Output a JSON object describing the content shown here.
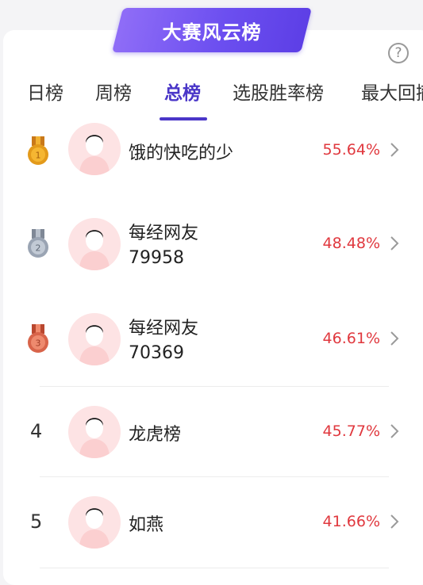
{
  "banner": {
    "title": "大赛风云榜"
  },
  "help_icon": "question-circle-icon",
  "tabs": [
    {
      "label": "日榜",
      "active": false
    },
    {
      "label": "周榜",
      "active": false
    },
    {
      "label": "总榜",
      "active": true
    },
    {
      "label": "选股胜率榜",
      "active": false
    },
    {
      "label": "最大回撤",
      "active": false
    }
  ],
  "colors": {
    "accent": "#4a36c8",
    "banner": "#6c4ff0",
    "positive": "#e0383e",
    "gold": "#e39a1b",
    "silver": "#9aa4b3",
    "bronze": "#d8644a"
  },
  "rankings": [
    {
      "rank": "1",
      "medal": "gold-medal-icon",
      "name": "饿的快吃的少",
      "name2": "",
      "pct": "55.64%"
    },
    {
      "rank": "2",
      "medal": "silver-medal-icon",
      "name": "每经网友",
      "name2": "79958",
      "pct": "48.48%"
    },
    {
      "rank": "3",
      "medal": "bronze-medal-icon",
      "name": "每经网友",
      "name2": "70369",
      "pct": "46.61%"
    },
    {
      "rank": "4",
      "medal": "",
      "name": "龙虎榜",
      "name2": "",
      "pct": "45.77%"
    },
    {
      "rank": "5",
      "medal": "",
      "name": "如燕",
      "name2": "",
      "pct": "41.66%"
    }
  ]
}
